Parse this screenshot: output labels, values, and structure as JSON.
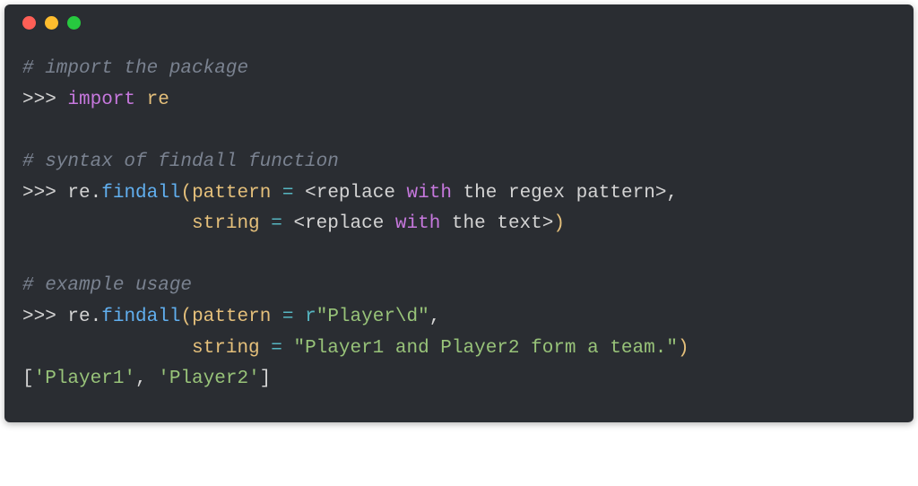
{
  "comments": {
    "c1": "# import the package",
    "c2": "# syntax of findall function",
    "c3": "# example usage"
  },
  "prompts": {
    "p1": ">>> ",
    "p2": ">>> ",
    "p3": ">>> "
  },
  "line_import": {
    "kw": "import",
    "mod": "re"
  },
  "line_syntax1": {
    "obj": "re",
    "dot": ".",
    "func": "findall",
    "open": "(",
    "param1": "pattern",
    "eq1": " = ",
    "angle_open1": "<",
    "word_replace1": "replace ",
    "word_with1": "with",
    "word_rest1": " the regex pattern",
    "angle_close1": ">",
    "comma1": ","
  },
  "line_syntax2": {
    "indent": "               ",
    "param2": "string",
    "eq2": " = ",
    "angle_open2": "<",
    "word_replace2": "replace ",
    "word_with2": "with",
    "word_rest2": " the text",
    "angle_close2": ">",
    "close": ")"
  },
  "line_ex1": {
    "obj": "re",
    "dot": ".",
    "func": "findall",
    "open": "(",
    "param1": "pattern",
    "eq1": " = ",
    "rprefix": "r",
    "str1": "\"Player\\d\"",
    "comma1": ","
  },
  "line_ex2": {
    "indent": "               ",
    "param2": "string",
    "eq2": " = ",
    "str2": "\"Player1 and Player2 form a team.\"",
    "close": ")"
  },
  "output": {
    "open": "[",
    "s1": "'Player1'",
    "comma": ", ",
    "s2": "'Player2'",
    "close": "]"
  }
}
